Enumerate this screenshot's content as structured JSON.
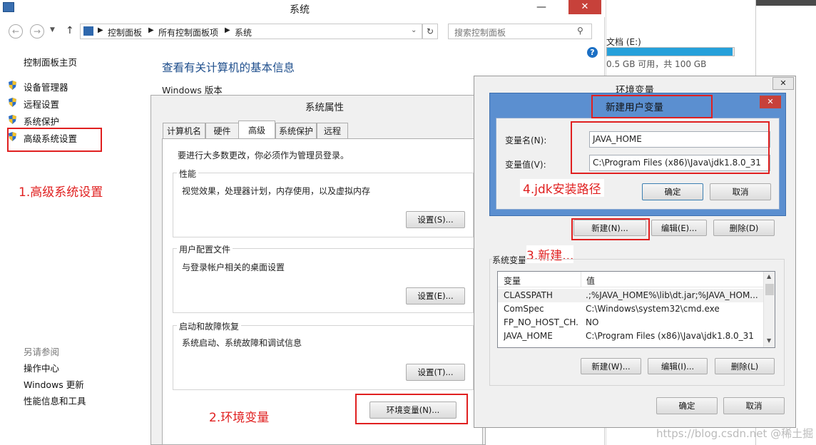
{
  "main_window": {
    "title": "系统",
    "path": [
      "控制面板",
      "所有控制面板项",
      "系统"
    ],
    "search_placeholder": "搜索控制面板",
    "heading": "查看有关计算机的基本信息",
    "windows_edition": "Windows 版本"
  },
  "sidebar": {
    "home": "控制面板主页",
    "items": [
      "设备管理器",
      "远程设置",
      "系统保护",
      "高级系统设置"
    ],
    "see_also_title": "另请参阅",
    "see_also": [
      "操作中心",
      "Windows 更新",
      "性能信息和工具"
    ]
  },
  "drive": {
    "name": "文档 (E:)",
    "info": "0.5 GB 可用，共 100 GB",
    "used_fraction": 0.99
  },
  "sys_props": {
    "title": "系统属性",
    "tabs": [
      "计算机名",
      "硬件",
      "高级",
      "系统保护",
      "远程"
    ],
    "active_tab": "高级",
    "admin_note": "要进行大多数更改，你必须作为管理员登录。",
    "perf_title": "性能",
    "perf_desc": "视觉效果，处理器计划，内存使用，以及虚拟内存",
    "perf_button": "设置(S)...",
    "profile_title": "用户配置文件",
    "profile_desc": "与登录帐户相关的桌面设置",
    "profile_button": "设置(E)...",
    "startup_title": "启动和故障恢复",
    "startup_desc": "系统启动、系统故障和调试信息",
    "startup_button": "设置(T)...",
    "env_button": "环境变量(N)..."
  },
  "env_vars": {
    "title": "环境变量",
    "new_button": "新建(N)...",
    "edit_button": "编辑(E)...",
    "delete_button": "删除(D)",
    "sys_group": "系统变量",
    "col_var": "变量",
    "col_val": "值",
    "rows": [
      {
        "name": "CLASSPATH",
        "value": ".;%JAVA_HOME%\\lib\\dt.jar;%JAVA_HOM..."
      },
      {
        "name": "ComSpec",
        "value": "C:\\Windows\\system32\\cmd.exe"
      },
      {
        "name": "FP_NO_HOST_CH...",
        "value": "NO"
      },
      {
        "name": "JAVA_HOME",
        "value": "C:\\Program Files (x86)\\Java\\jdk1.8.0_31"
      }
    ],
    "sys_new": "新建(W)...",
    "sys_edit": "编辑(I)...",
    "sys_delete": "删除(L)",
    "ok": "确定",
    "cancel": "取消"
  },
  "new_var": {
    "title": "新建用户变量",
    "name_label": "变量名(N):",
    "name_value": "JAVA_HOME",
    "value_label": "变量值(V):",
    "value_value": "C:\\Program Files (x86)\\Java\\jdk1.8.0_31",
    "ok": "确定",
    "cancel": "取消"
  },
  "annotations": [
    "1.高级系统设置",
    "2.环境变量",
    "3.新建...",
    "4.jdk安装路径"
  ],
  "watermark": "https://blog.csdn.net @稀土掘金技术社区",
  "colors": {
    "annotation": "#e02020",
    "dialog_blue": "#5b8fd0",
    "close_red": "#c7413a",
    "link_blue": "#1e4e8c"
  }
}
